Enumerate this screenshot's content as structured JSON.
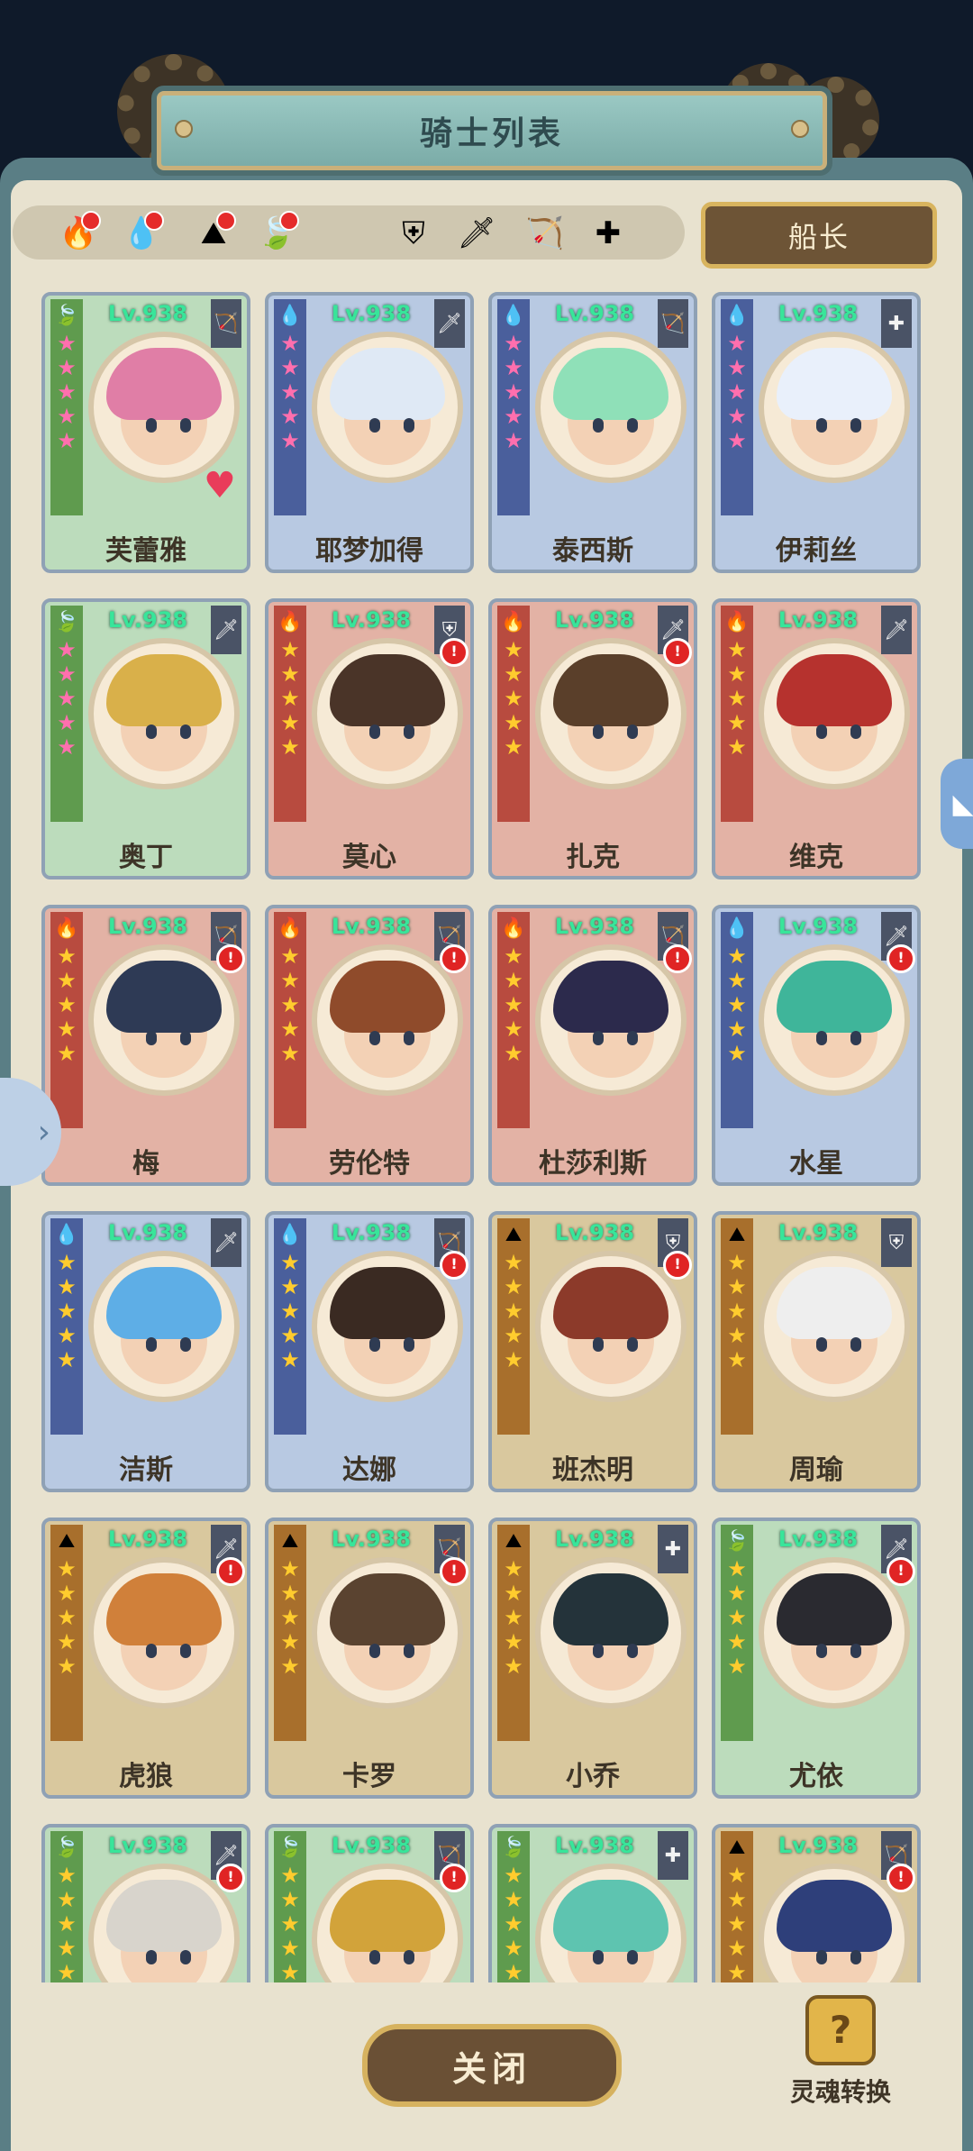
{
  "window": {
    "title": "骑士列表"
  },
  "filters": {
    "elements": [
      {
        "icon": "fire-element-icon",
        "glyph": "🔥",
        "alert": true
      },
      {
        "icon": "water-element-icon",
        "glyph": "💧",
        "alert": true
      },
      {
        "icon": "earth-element-icon",
        "glyph": "⛰",
        "alert": true
      },
      {
        "icon": "wood-element-icon",
        "glyph": "🍃",
        "alert": true
      }
    ],
    "classes": [
      {
        "icon": "shield-class-icon",
        "glyph": "⛨"
      },
      {
        "icon": "sword-class-icon",
        "glyph": "🗡"
      },
      {
        "icon": "bow-class-icon",
        "glyph": "🏹"
      },
      {
        "icon": "healer-cross-icon",
        "glyph": "✚"
      }
    ]
  },
  "captain_button": {
    "label": "船长"
  },
  "knights": [
    {
      "name": "芙蕾雅",
      "level": "Lv.938",
      "element": "wood",
      "class_icon": "🏹",
      "stars": 5,
      "star_color": "pink",
      "alert": false,
      "favorite": true,
      "hair": "#e07ea6"
    },
    {
      "name": "耶梦加得",
      "level": "Lv.938",
      "element": "water",
      "class_icon": "🗡",
      "stars": 5,
      "star_color": "pink",
      "alert": false,
      "favorite": false,
      "hair": "#dfe9f5"
    },
    {
      "name": "泰西斯",
      "level": "Lv.938",
      "element": "water",
      "class_icon": "🏹",
      "stars": 5,
      "star_color": "pink",
      "alert": false,
      "favorite": false,
      "hair": "#8fe0b8"
    },
    {
      "name": "伊莉丝",
      "level": "Lv.938",
      "element": "water",
      "class_icon": "✚",
      "stars": 5,
      "star_color": "pink",
      "alert": false,
      "favorite": false,
      "hair": "#e9f0fb"
    },
    {
      "name": "奥丁",
      "level": "Lv.938",
      "element": "wood",
      "class_icon": "🗡",
      "stars": 5,
      "star_color": "pink",
      "alert": false,
      "favorite": false,
      "hair": "#d9b04a"
    },
    {
      "name": "莫心",
      "level": "Lv.938",
      "element": "fire",
      "class_icon": "⛨",
      "stars": 5,
      "star_color": "gold",
      "alert": true,
      "favorite": false,
      "hair": "#4a3428"
    },
    {
      "name": "扎克",
      "level": "Lv.938",
      "element": "fire",
      "class_icon": "🗡",
      "stars": 5,
      "star_color": "gold",
      "alert": true,
      "favorite": false,
      "hair": "#5a3f2a"
    },
    {
      "name": "维克",
      "level": "Lv.938",
      "element": "fire",
      "class_icon": "🗡",
      "stars": 5,
      "star_color": "gold",
      "alert": false,
      "favorite": false,
      "hair": "#b6322e"
    },
    {
      "name": "梅",
      "level": "Lv.938",
      "element": "fire",
      "class_icon": "🏹",
      "stars": 5,
      "star_color": "gold",
      "alert": true,
      "favorite": false,
      "hair": "#2e3a55"
    },
    {
      "name": "劳伦特",
      "level": "Lv.938",
      "element": "fire",
      "class_icon": "🏹",
      "stars": 5,
      "star_color": "gold",
      "alert": true,
      "favorite": false,
      "hair": "#8f4b2b"
    },
    {
      "name": "杜莎利斯",
      "level": "Lv.938",
      "element": "fire",
      "class_icon": "🏹",
      "stars": 5,
      "star_color": "gold",
      "alert": true,
      "favorite": false,
      "hair": "#2c2a4c"
    },
    {
      "name": "水星",
      "level": "Lv.938",
      "element": "water",
      "class_icon": "🗡",
      "stars": 5,
      "star_color": "gold",
      "alert": true,
      "favorite": false,
      "hair": "#3fb59a"
    },
    {
      "name": "洁斯",
      "level": "Lv.938",
      "element": "water",
      "class_icon": "🗡",
      "stars": 5,
      "star_color": "gold",
      "alert": false,
      "favorite": false,
      "hair": "#5eaee6"
    },
    {
      "name": "达娜",
      "level": "Lv.938",
      "element": "water",
      "class_icon": "🏹",
      "stars": 5,
      "star_color": "gold",
      "alert": true,
      "favorite": false,
      "hair": "#3a2a22"
    },
    {
      "name": "班杰明",
      "level": "Lv.938",
      "element": "earth",
      "class_icon": "⛨",
      "stars": 5,
      "star_color": "gold",
      "alert": true,
      "favorite": false,
      "hair": "#8c3a2a"
    },
    {
      "name": "周瑜",
      "level": "Lv.938",
      "element": "earth",
      "class_icon": "⛨",
      "stars": 5,
      "star_color": "gold",
      "alert": false,
      "favorite": false,
      "hair": "#eeeeee"
    },
    {
      "name": "虎狼",
      "level": "Lv.938",
      "element": "earth",
      "class_icon": "🗡",
      "stars": 5,
      "star_color": "gold",
      "alert": true,
      "favorite": false,
      "hair": "#d0803a"
    },
    {
      "name": "卡罗",
      "level": "Lv.938",
      "element": "earth",
      "class_icon": "🏹",
      "stars": 5,
      "star_color": "gold",
      "alert": true,
      "favorite": false,
      "hair": "#5a4330"
    },
    {
      "name": "小乔",
      "level": "Lv.938",
      "element": "earth",
      "class_icon": "✚",
      "stars": 5,
      "star_color": "gold",
      "alert": false,
      "favorite": false,
      "hair": "#24333a"
    },
    {
      "name": "尤依",
      "level": "Lv.938",
      "element": "wood",
      "class_icon": "🗡",
      "stars": 5,
      "star_color": "gold",
      "alert": true,
      "favorite": false,
      "hair": "#2a2a30"
    },
    {
      "name": "",
      "level": "Lv.938",
      "element": "wood",
      "class_icon": "🗡",
      "stars": 5,
      "star_color": "gold",
      "alert": true,
      "favorite": false,
      "hair": "#d8d4cc"
    },
    {
      "name": "",
      "level": "Lv.938",
      "element": "wood",
      "class_icon": "🏹",
      "stars": 5,
      "star_color": "gold",
      "alert": true,
      "favorite": false,
      "hair": "#d2a33a"
    },
    {
      "name": "",
      "level": "Lv.938",
      "element": "wood",
      "class_icon": "✚",
      "stars": 5,
      "star_color": "gold",
      "alert": false,
      "favorite": false,
      "hair": "#5ec4b0"
    },
    {
      "name": "",
      "level": "Lv.938",
      "element": "earth",
      "class_icon": "🏹",
      "stars": 5,
      "star_color": "gold",
      "alert": true,
      "favorite": false,
      "hair": "#2e3f7a"
    }
  ],
  "element_glyphs": {
    "water": "💧",
    "fire": "🔥",
    "wood": "🍃",
    "earth": "⛰"
  },
  "close_button": {
    "label": "关闭"
  },
  "soul_convert": {
    "label": "灵魂转换",
    "glyph": "?"
  },
  "side_tabs": {
    "left_glyph": "›",
    "right_glyph": "◣"
  }
}
